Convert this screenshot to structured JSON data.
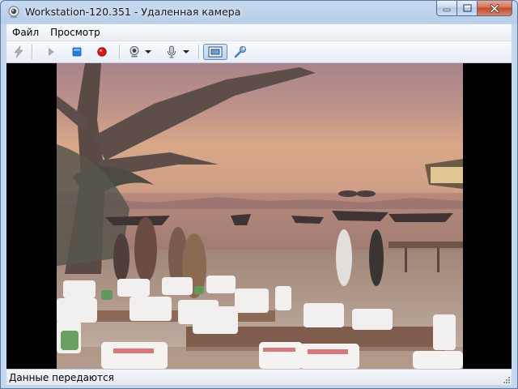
{
  "window": {
    "title": "Workstation-120.351 - Удаленная камера",
    "icon": "webcam-icon",
    "buttons": [
      "minimize-icon",
      "maximize-icon",
      "close-icon"
    ]
  },
  "menu": {
    "items": [
      {
        "label": "Файл"
      },
      {
        "label": "Просмотр"
      }
    ]
  },
  "toolbar": {
    "buttons": [
      {
        "icon": "lightning-icon",
        "enabled": false
      },
      {
        "icon": "play-icon",
        "enabled": false
      },
      {
        "icon": "stop-icon",
        "color": "#1f7ee0"
      },
      {
        "icon": "record-icon",
        "color": "#d41818"
      },
      {
        "icon": "camera-icon",
        "dropdown": true
      },
      {
        "icon": "microphone-icon",
        "dropdown": true
      },
      {
        "icon": "fit-to-window-icon",
        "pressed": true
      },
      {
        "icon": "wrench-icon"
      }
    ]
  },
  "video": {
    "scene": "beach-sunset-photo"
  },
  "status": {
    "text": "Данные передаются"
  }
}
